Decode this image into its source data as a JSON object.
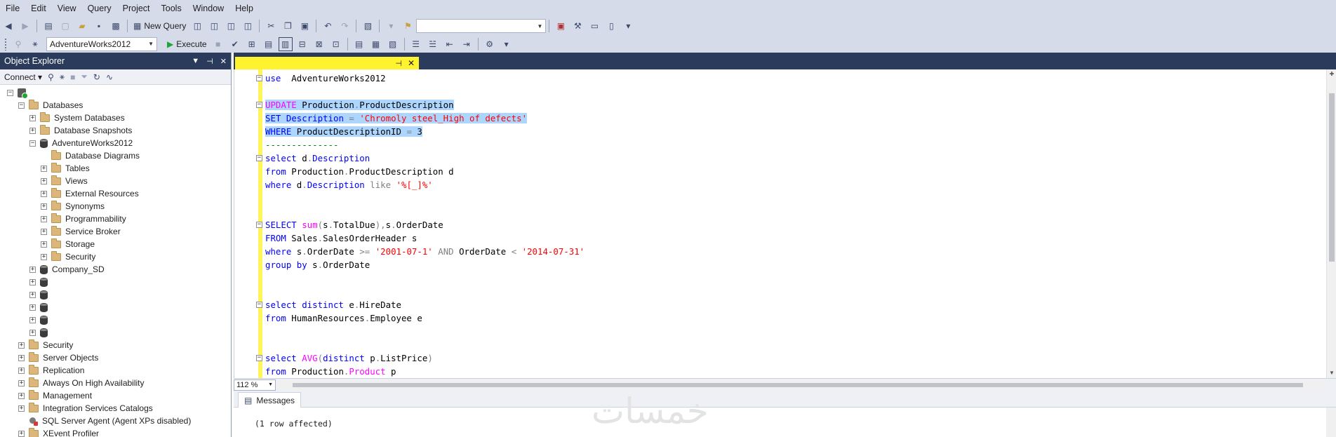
{
  "menu": [
    "File",
    "Edit",
    "View",
    "Query",
    "Project",
    "Tools",
    "Window",
    "Help"
  ],
  "toolbar1": {
    "new_query_label": "New Query",
    "search_combo_value": ""
  },
  "toolbar2": {
    "database_combo_value": "AdventureWorks2012",
    "execute_label": "Execute"
  },
  "object_explorer": {
    "title": "Object Explorer",
    "header_icons": [
      "▼",
      "⊣",
      "✕"
    ],
    "connect_label": "Connect",
    "tree": [
      {
        "label": "",
        "level": 0,
        "icon": "server",
        "expander": "−"
      },
      {
        "label": "Databases",
        "level": 1,
        "icon": "folder",
        "expander": "−"
      },
      {
        "label": "System Databases",
        "level": 2,
        "icon": "folder",
        "expander": "+"
      },
      {
        "label": "Database Snapshots",
        "level": 2,
        "icon": "folder",
        "expander": "+"
      },
      {
        "label": "AdventureWorks2012",
        "level": 2,
        "icon": "database",
        "expander": "−"
      },
      {
        "label": "Database Diagrams",
        "level": 3,
        "icon": "folder",
        "expander": ""
      },
      {
        "label": "Tables",
        "level": 3,
        "icon": "folder",
        "expander": "+"
      },
      {
        "label": "Views",
        "level": 3,
        "icon": "folder",
        "expander": "+"
      },
      {
        "label": "External Resources",
        "level": 3,
        "icon": "folder",
        "expander": "+"
      },
      {
        "label": "Synonyms",
        "level": 3,
        "icon": "folder",
        "expander": "+"
      },
      {
        "label": "Programmability",
        "level": 3,
        "icon": "folder",
        "expander": "+"
      },
      {
        "label": "Service Broker",
        "level": 3,
        "icon": "folder",
        "expander": "+"
      },
      {
        "label": "Storage",
        "level": 3,
        "icon": "folder",
        "expander": "+"
      },
      {
        "label": "Security",
        "level": 3,
        "icon": "folder",
        "expander": "+"
      },
      {
        "label": "Company_SD",
        "level": 2,
        "icon": "database",
        "expander": "+"
      },
      {
        "label": "",
        "level": 2,
        "icon": "database",
        "expander": "+"
      },
      {
        "label": "",
        "level": 2,
        "icon": "database",
        "expander": "+"
      },
      {
        "label": "",
        "level": 2,
        "icon": "database",
        "expander": "+"
      },
      {
        "label": "",
        "level": 2,
        "icon": "database",
        "expander": "+"
      },
      {
        "label": "",
        "level": 2,
        "icon": "database",
        "expander": "+"
      },
      {
        "label": "Security",
        "level": 1,
        "icon": "folder",
        "expander": "+"
      },
      {
        "label": "Server Objects",
        "level": 1,
        "icon": "folder",
        "expander": "+"
      },
      {
        "label": "Replication",
        "level": 1,
        "icon": "folder",
        "expander": "+"
      },
      {
        "label": "Always On High Availability",
        "level": 1,
        "icon": "folder",
        "expander": "+"
      },
      {
        "label": "Management",
        "level": 1,
        "icon": "folder",
        "expander": "+"
      },
      {
        "label": "Integration Services Catalogs",
        "level": 1,
        "icon": "folder",
        "expander": "+"
      },
      {
        "label": "SQL Server Agent (Agent XPs disabled)",
        "level": 1,
        "icon": "agent",
        "expander": ""
      },
      {
        "label": "XEvent Profiler",
        "level": 1,
        "icon": "folder",
        "expander": "+"
      }
    ]
  },
  "editor": {
    "tab_label": "",
    "code_lines": [
      {
        "fold": "−",
        "highlight": false,
        "tokens": [
          [
            "kw",
            "use"
          ],
          [
            "",
            "  AdventureWorks2012"
          ]
        ]
      },
      {
        "fold": "",
        "highlight": false,
        "tokens": []
      },
      {
        "fold": "−",
        "highlight": true,
        "tokens": [
          [
            "fn",
            "UPDATE"
          ],
          [
            "",
            " Production"
          ],
          [
            "op",
            "."
          ],
          [
            "",
            "ProductDescription"
          ]
        ]
      },
      {
        "fold": "",
        "highlight": true,
        "tokens": [
          [
            "kw",
            "SET"
          ],
          [
            "",
            " "
          ],
          [
            "kw",
            "Description"
          ],
          [
            "",
            " "
          ],
          [
            "op",
            "="
          ],
          [
            "",
            " "
          ],
          [
            "str",
            "'Chromoly steel_High of defects'"
          ]
        ]
      },
      {
        "fold": "",
        "highlight": true,
        "tokens": [
          [
            "kw",
            "WHERE"
          ],
          [
            "",
            " ProductDescriptionID "
          ],
          [
            "op",
            "="
          ],
          [
            "",
            " 3"
          ]
        ]
      },
      {
        "fold": "",
        "highlight": false,
        "tokens": [
          [
            "cm",
            "--------------"
          ]
        ]
      },
      {
        "fold": "−",
        "highlight": false,
        "tokens": [
          [
            "kw",
            "select"
          ],
          [
            "",
            " d"
          ],
          [
            "op",
            "."
          ],
          [
            "kw",
            "Description"
          ]
        ]
      },
      {
        "fold": "",
        "highlight": false,
        "tokens": [
          [
            "kw",
            "from"
          ],
          [
            "",
            " Production"
          ],
          [
            "op",
            "."
          ],
          [
            "",
            "ProductDescription d"
          ]
        ]
      },
      {
        "fold": "",
        "highlight": false,
        "tokens": [
          [
            "kw",
            "where"
          ],
          [
            "",
            " d"
          ],
          [
            "op",
            "."
          ],
          [
            "kw",
            "Description"
          ],
          [
            "",
            " "
          ],
          [
            "op",
            "like"
          ],
          [
            "",
            " "
          ],
          [
            "str",
            "'%[_]%'"
          ]
        ]
      },
      {
        "fold": "",
        "highlight": false,
        "tokens": []
      },
      {
        "fold": "",
        "highlight": false,
        "tokens": []
      },
      {
        "fold": "−",
        "highlight": false,
        "tokens": [
          [
            "kw",
            "SELECT"
          ],
          [
            "",
            " "
          ],
          [
            "fn",
            "sum"
          ],
          [
            "op",
            "("
          ],
          [
            "",
            "s"
          ],
          [
            "op",
            "."
          ],
          [
            "",
            "TotalDue"
          ],
          [
            "op",
            "),"
          ],
          [
            "",
            "s"
          ],
          [
            "op",
            "."
          ],
          [
            "",
            "OrderDate"
          ]
        ]
      },
      {
        "fold": "",
        "highlight": false,
        "tokens": [
          [
            "kw",
            "FROM"
          ],
          [
            "",
            " Sales"
          ],
          [
            "op",
            "."
          ],
          [
            "",
            "SalesOrderHeader s"
          ]
        ]
      },
      {
        "fold": "",
        "highlight": false,
        "tokens": [
          [
            "kw",
            "where"
          ],
          [
            "",
            " s"
          ],
          [
            "op",
            "."
          ],
          [
            "",
            "OrderDate "
          ],
          [
            "op",
            ">="
          ],
          [
            "",
            " "
          ],
          [
            "str",
            "'2001-07-1'"
          ],
          [
            "",
            " "
          ],
          [
            "op",
            "AND"
          ],
          [
            "",
            " OrderDate "
          ],
          [
            "op",
            "<"
          ],
          [
            "",
            " "
          ],
          [
            "str",
            "'2014-07-31'"
          ]
        ]
      },
      {
        "fold": "",
        "highlight": false,
        "tokens": [
          [
            "kw",
            "group by"
          ],
          [
            "",
            " s"
          ],
          [
            "op",
            "."
          ],
          [
            "",
            "OrderDate"
          ]
        ]
      },
      {
        "fold": "",
        "highlight": false,
        "tokens": []
      },
      {
        "fold": "",
        "highlight": false,
        "tokens": []
      },
      {
        "fold": "−",
        "highlight": false,
        "tokens": [
          [
            "kw",
            "select distinct"
          ],
          [
            "",
            " e"
          ],
          [
            "op",
            "."
          ],
          [
            "",
            "HireDate"
          ]
        ]
      },
      {
        "fold": "",
        "highlight": false,
        "tokens": [
          [
            "kw",
            "from"
          ],
          [
            "",
            " HumanResources"
          ],
          [
            "op",
            "."
          ],
          [
            "",
            "Employee e"
          ]
        ]
      },
      {
        "fold": "",
        "highlight": false,
        "tokens": []
      },
      {
        "fold": "",
        "highlight": false,
        "tokens": []
      },
      {
        "fold": "−",
        "highlight": false,
        "tokens": [
          [
            "kw",
            "select"
          ],
          [
            "",
            " "
          ],
          [
            "fn",
            "AVG"
          ],
          [
            "op",
            "("
          ],
          [
            "kw",
            "distinct"
          ],
          [
            "",
            " p"
          ],
          [
            "op",
            "."
          ],
          [
            "",
            "ListPrice"
          ],
          [
            "op",
            ")"
          ]
        ]
      },
      {
        "fold": "",
        "highlight": false,
        "tokens": [
          [
            "kw",
            "from"
          ],
          [
            "",
            " Production"
          ],
          [
            "op",
            "."
          ],
          [
            "fn",
            "Product"
          ],
          [
            "",
            " p"
          ]
        ]
      }
    ]
  },
  "zoom": "112 %",
  "results": {
    "tab_label": "Messages",
    "message": "(1 row affected)",
    "watermark": "خمسات"
  },
  "colors": {
    "chrome": "#d6dbe9",
    "dark_header": "#2b3b5c",
    "tab_yellow": "#fff22e",
    "selection": "#add6ff"
  }
}
